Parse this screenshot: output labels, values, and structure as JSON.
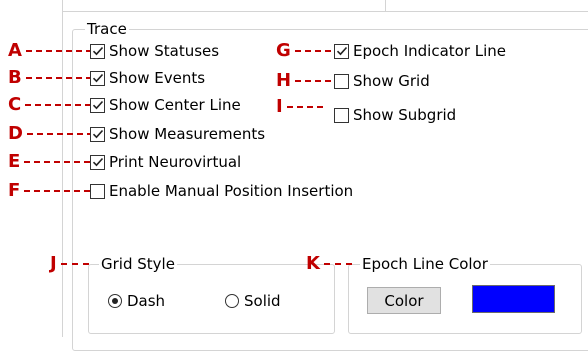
{
  "trace": {
    "title": "Trace",
    "left_checkboxes": [
      {
        "letter": "A",
        "label": "Show Statuses",
        "checked": true
      },
      {
        "letter": "B",
        "label": "Show Events",
        "checked": true
      },
      {
        "letter": "C",
        "label": "Show Center Line",
        "checked": true
      },
      {
        "letter": "D",
        "label": "Show Measurements",
        "checked": true
      },
      {
        "letter": "E",
        "label": "Print Neurovirtual",
        "checked": true
      },
      {
        "letter": "F",
        "label": "Enable Manual Position Insertion",
        "checked": false
      }
    ],
    "right_checkboxes": [
      {
        "letter": "G",
        "label": "Epoch Indicator Line",
        "checked": true
      },
      {
        "letter": "H",
        "label": "Show Grid",
        "checked": false
      },
      {
        "letter": "I",
        "label": "Show Subgrid",
        "checked": false
      }
    ]
  },
  "grid_style": {
    "letter": "J",
    "title": "Grid Style",
    "options": [
      {
        "label": "Dash",
        "selected": true
      },
      {
        "label": "Solid",
        "selected": false
      }
    ]
  },
  "epoch_line_color": {
    "letter": "K",
    "title": "Epoch Line Color",
    "button_label": "Color",
    "swatch_color": "#0000ff"
  },
  "colors": {
    "callout": "#c00000",
    "border": "#d4d4d4"
  }
}
